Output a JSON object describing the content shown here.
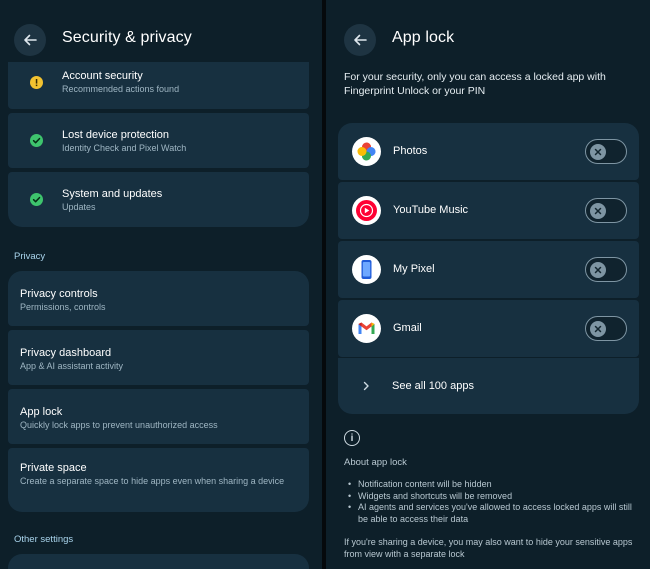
{
  "left": {
    "title": "Security & privacy",
    "status_items": [
      {
        "title": "Account security",
        "subtitle": "Recommended actions found",
        "status": "warning"
      },
      {
        "title": "Lost device protection",
        "subtitle": "Identity Check and Pixel Watch",
        "status": "ok"
      },
      {
        "title": "System and updates",
        "subtitle": "Updates",
        "status": "ok"
      }
    ],
    "privacy_label": "Privacy",
    "privacy_items": [
      {
        "title": "Privacy controls",
        "subtitle": "Permissions, controls"
      },
      {
        "title": "Privacy dashboard",
        "subtitle": "App & AI assistant activity"
      },
      {
        "title": "App lock",
        "subtitle": "Quickly lock apps to prevent unauthorized access"
      },
      {
        "title": "Private space",
        "subtitle": "Create a separate space to hide apps even when sharing a device"
      }
    ],
    "other_label": "Other settings"
  },
  "right": {
    "title": "App lock",
    "intro": "For your security, only you can access a locked app with Fingerprint Unlock or your PIN",
    "apps": [
      {
        "name": "Photos",
        "icon": "photos-icon",
        "locked": false
      },
      {
        "name": "YouTube Music",
        "icon": "youtube-music-icon",
        "locked": false
      },
      {
        "name": "My Pixel",
        "icon": "my-pixel-icon",
        "locked": false
      },
      {
        "name": "Gmail",
        "icon": "gmail-icon",
        "locked": false
      }
    ],
    "see_all": "See all 100 apps",
    "about_title": "About app lock",
    "about_bullets": [
      "Notification content will be hidden",
      "Widgets and shortcuts will be removed",
      "AI agents and services you've allowed to access locked apps will still be able to access their data"
    ],
    "footer": "If you're sharing a device, you may also want to hide your sensitive apps from view with a separate lock"
  },
  "colors": {
    "background": "#0d1f29",
    "card": "#173040",
    "warning": "#f2c230",
    "ok": "#3ec46d",
    "accent_label": "#a9d4ec"
  }
}
